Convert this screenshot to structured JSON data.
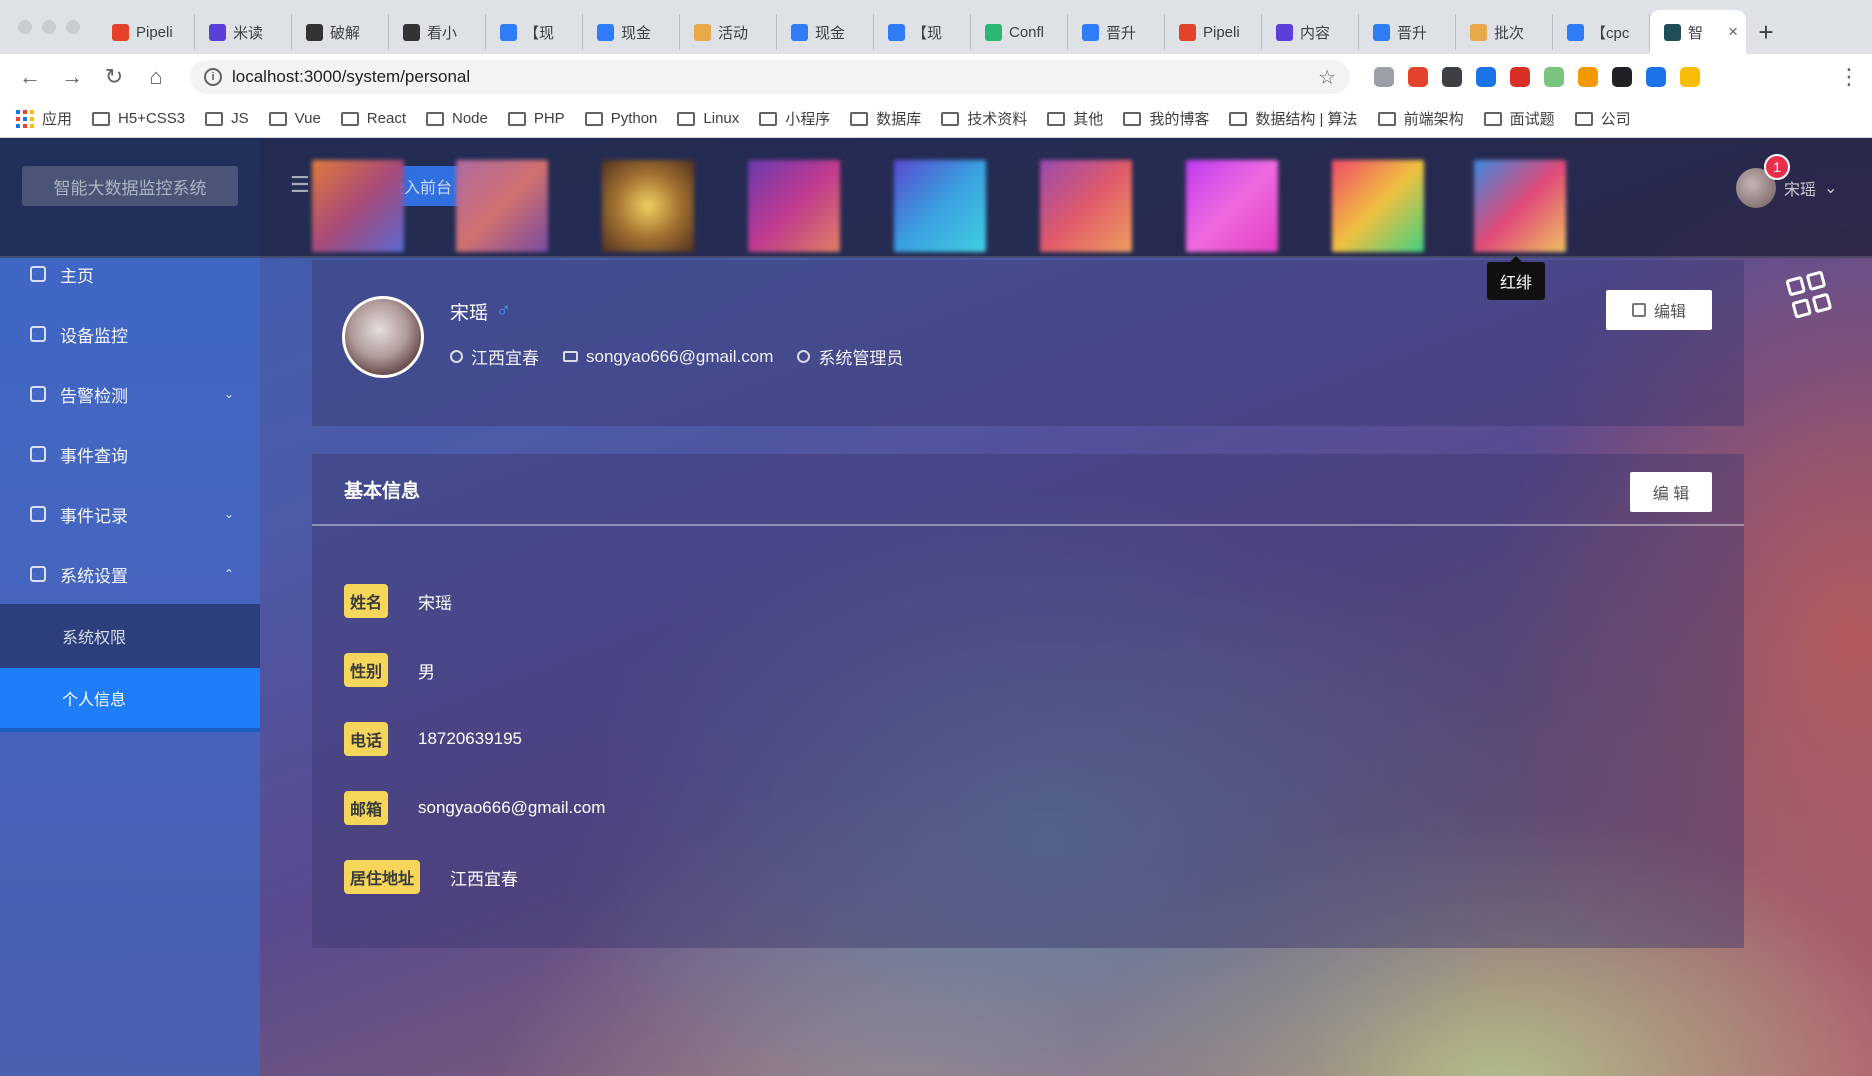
{
  "browser": {
    "tabs": [
      {
        "label": "Pipeli",
        "color": "#e2432a"
      },
      {
        "label": "米读",
        "color": "#5b3fd6"
      },
      {
        "label": "破解",
        "color": "#333333"
      },
      {
        "label": "看小",
        "color": "#333333"
      },
      {
        "label": "【现",
        "color": "#2f7df6"
      },
      {
        "label": "现金",
        "color": "#2f7df6"
      },
      {
        "label": "活动",
        "color": "#e8a94a"
      },
      {
        "label": "现金",
        "color": "#2f7df6"
      },
      {
        "label": "【现",
        "color": "#2f7df6"
      },
      {
        "label": "Confl",
        "color": "#2bb673"
      },
      {
        "label": "晋升",
        "color": "#2f7df6"
      },
      {
        "label": "Pipeli",
        "color": "#e2432a"
      },
      {
        "label": "内容",
        "color": "#5b3fd6"
      },
      {
        "label": "晋升",
        "color": "#2f7df6"
      },
      {
        "label": "批次",
        "color": "#e8a94a"
      },
      {
        "label": "【cpc",
        "color": "#2f7df6"
      },
      {
        "label": "智",
        "color": "#1f4e5a"
      }
    ],
    "new_tab": "+",
    "close": "×",
    "url": "localhost:3000/system/personal",
    "star": "☆",
    "nav": {
      "back": "←",
      "forward": "→",
      "reload": "↻",
      "home": "⌂",
      "menu": "⋮"
    },
    "extension_colors": [
      "#9aa0a6",
      "#e2432a",
      "#3c4043",
      "#1a73e8",
      "#d93025",
      "#7ac47f",
      "#f29900",
      "#202124",
      "#1a73e8",
      "#fbbc04"
    ],
    "bookmarks": [
      "应用",
      "H5+CSS3",
      "JS",
      "Vue",
      "React",
      "Node",
      "PHP",
      "Python",
      "Linux",
      "小程序",
      "数据库",
      "技术资料",
      "其他",
      "我的博客",
      "数据结构 | 算法",
      "前端架构",
      "面试题",
      "公司"
    ]
  },
  "app": {
    "logo_text": "智能大数据监控系统",
    "collapse_icon": "☰",
    "front_button": "进入前台",
    "theme_tooltip": "红绯",
    "username": "宋瑶",
    "notification_count": "1",
    "dropdown_icon": "⌄",
    "theme_swatches": [
      "linear-gradient(135deg,#e07a3a,#a84a7a,#5a6ad0)",
      "linear-gradient(135deg,#b06aa0,#d07070,#7a4aa0)",
      "radial-gradient(circle,#f0d060,#a07030,#503020)",
      "linear-gradient(135deg,#6a3ab0,#c03a90,#e08060)",
      "linear-gradient(135deg,#5a4ad0,#3aa0e0,#40d0e0)",
      "linear-gradient(135deg,#9a4ab0,#e05a6a,#f0a060)",
      "linear-gradient(135deg,#c03af0,#f06ae0,#e040c0)",
      "linear-gradient(135deg,#f04a6a,#f0c040,#40d080)",
      "linear-gradient(135deg,#3a8ae0,#e04a7a,#f0c060)"
    ],
    "sidebar": {
      "items": [
        {
          "label": "主页",
          "arrow": ""
        },
        {
          "label": "设备监控",
          "arrow": ""
        },
        {
          "label": "告警检测",
          "arrow": "⌄"
        },
        {
          "label": "事件查询",
          "arrow": ""
        },
        {
          "label": "事件记录",
          "arrow": "⌄"
        },
        {
          "label": "系统设置",
          "arrow": "⌃"
        }
      ],
      "sub_items": [
        {
          "label": "系统权限"
        },
        {
          "label": "个人信息"
        }
      ]
    },
    "profile": {
      "name": "宋瑶",
      "gender_icon": "♂",
      "location": "江西宜春",
      "email": "songyao666@gmail.com",
      "role": "系统管理员",
      "edit_label": "编辑"
    },
    "basic_info": {
      "title": "基本信息",
      "edit_label": "编 辑",
      "rows": [
        {
          "label": "姓名",
          "value": "宋瑶"
        },
        {
          "label": "性别",
          "value": "男"
        },
        {
          "label": "电话",
          "value": "18720639195"
        },
        {
          "label": "邮箱",
          "value": "songyao666@gmail.com"
        },
        {
          "label": "居住地址",
          "value": "江西宜春"
        }
      ]
    }
  }
}
